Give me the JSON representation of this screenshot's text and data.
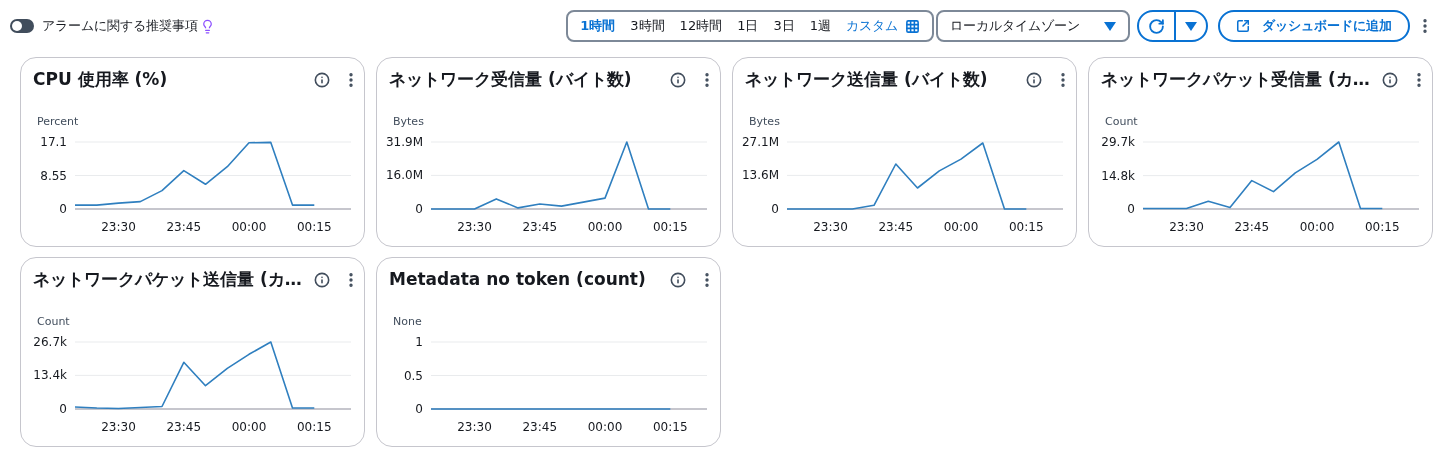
{
  "toolbar": {
    "alarm_toggle": {
      "label": "アラームに関する推奨事項",
      "on": false
    },
    "time_ranges": [
      {
        "label": "1時間",
        "selected": true
      },
      {
        "label": "3時間",
        "selected": false
      },
      {
        "label": "12時間",
        "selected": false
      },
      {
        "label": "1日",
        "selected": false
      },
      {
        "label": "3日",
        "selected": false
      },
      {
        "label": "1週",
        "selected": false
      }
    ],
    "custom_range": {
      "label": "カスタム"
    },
    "timezone": {
      "value": "ローカルタイムゾーン"
    },
    "add_button": {
      "label": "ダッシュボードに追加"
    }
  },
  "widgets": [
    {
      "title": "CPU 使用率 (%)",
      "chart_data": {
        "type": "line",
        "ylabel": "Percent",
        "categories": [
          null,
          null,
          "23:30",
          null,
          null,
          "23:45",
          null,
          null,
          "00:00",
          null,
          null,
          "00:15"
        ],
        "ylim": [
          0,
          17.1
        ],
        "yticks": [
          0,
          8.55,
          17.1
        ],
        "series": [
          {
            "color": "#2f7fbf",
            "values": [
              1.0,
              1.0,
              1.5,
              1.9,
              4.7,
              9.8,
              6.3,
              10.8,
              16.9,
              17.0,
              1.0,
              1.0
            ]
          }
        ]
      }
    },
    {
      "title": "ネットワーク受信量 (バイト数)",
      "chart_data": {
        "type": "line",
        "ylabel": "Bytes",
        "categories": [
          null,
          null,
          "23:30",
          null,
          null,
          "23:45",
          null,
          null,
          "00:00",
          null,
          null,
          "00:15"
        ],
        "ylim": [
          0,
          31.9
        ],
        "yticks": [
          {
            "value": 0,
            "label": "0"
          },
          {
            "value": 16.0,
            "label": "16.0M"
          },
          {
            "value": 31.9,
            "label": "31.9M"
          }
        ],
        "series": [
          {
            "color": "#2f7fbf",
            "values": [
              0,
              0,
              0,
              4.8,
              0.5,
              2.4,
              1.4,
              3.3,
              5.2,
              31.9,
              0,
              0
            ]
          }
        ]
      }
    },
    {
      "title": "ネットワーク送信量 (バイト数)",
      "chart_data": {
        "type": "line",
        "ylabel": "Bytes",
        "categories": [
          null,
          null,
          "23:30",
          null,
          null,
          "23:45",
          null,
          null,
          "00:00",
          null,
          null,
          "00:15"
        ],
        "ylim": [
          0,
          27.1
        ],
        "yticks": [
          {
            "value": 0,
            "label": "0"
          },
          {
            "value": 13.6,
            "label": "13.6M"
          },
          {
            "value": 27.1,
            "label": "27.1M"
          }
        ],
        "series": [
          {
            "color": "#2f7fbf",
            "values": [
              0,
              0,
              0,
              0,
              1.5,
              18.2,
              8.5,
              15.4,
              20.2,
              26.7,
              0,
              0
            ]
          }
        ]
      }
    },
    {
      "title": "ネットワークパケット受信量 (カ…",
      "chart_data": {
        "type": "line",
        "ylabel": "Count",
        "categories": [
          null,
          null,
          "23:30",
          null,
          null,
          "23:45",
          null,
          null,
          "00:00",
          null,
          null,
          "00:15"
        ],
        "ylim": [
          0,
          29.7
        ],
        "yticks": [
          {
            "value": 0,
            "label": "0"
          },
          {
            "value": 14.8,
            "label": "14.8k"
          },
          {
            "value": 29.7,
            "label": "29.7k"
          }
        ],
        "series": [
          {
            "color": "#2f7fbf",
            "values": [
              0.2,
              0.2,
              0.2,
              3.4,
              0.6,
              12.6,
              7.7,
              16.0,
              22.0,
              29.7,
              0.2,
              0.2
            ]
          }
        ]
      }
    },
    {
      "title": "ネットワークパケット送信量 (カ…",
      "chart_data": {
        "type": "line",
        "ylabel": "Count",
        "categories": [
          null,
          null,
          "23:30",
          null,
          null,
          "23:45",
          null,
          null,
          "00:00",
          null,
          null,
          "00:15"
        ],
        "ylim": [
          0,
          26.7
        ],
        "yticks": [
          {
            "value": 0,
            "label": "0"
          },
          {
            "value": 13.4,
            "label": "13.4k"
          },
          {
            "value": 26.7,
            "label": "26.7k"
          }
        ],
        "series": [
          {
            "color": "#2f7fbf",
            "values": [
              0.8,
              0.4,
              0.2,
              0.6,
              1.0,
              18.6,
              9.3,
              16.2,
              21.8,
              26.7,
              0.4,
              0.4
            ]
          }
        ]
      }
    },
    {
      "title": "Metadata no token (count)",
      "chart_data": {
        "type": "line",
        "ylabel": "None",
        "categories": [
          null,
          null,
          "23:30",
          null,
          null,
          "23:45",
          null,
          null,
          "00:00",
          null,
          null,
          "00:15"
        ],
        "ylim": [
          0,
          1
        ],
        "yticks": [
          0,
          0.5,
          1
        ],
        "series": [
          {
            "color": "#2f7fbf",
            "values": [
              0,
              0,
              0,
              0,
              0,
              0,
              0,
              0,
              0,
              0,
              0,
              0
            ]
          }
        ]
      }
    }
  ]
}
